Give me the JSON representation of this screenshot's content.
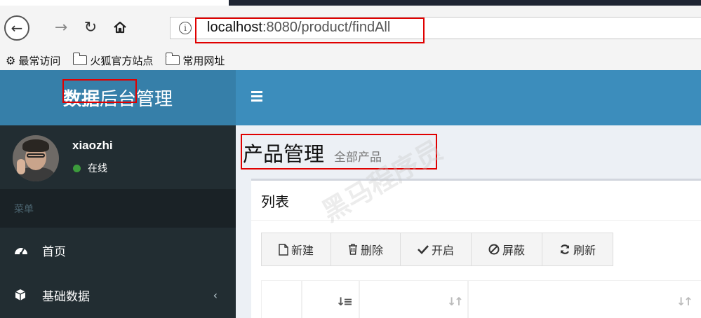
{
  "browser": {
    "url_host": "localhost",
    "url_port": ":8080",
    "url_path": "/product/findAll",
    "bookmarks": [
      {
        "label": "最常访问",
        "icon": "gear-icon"
      },
      {
        "label": "火狐官方站点",
        "icon": "folder-icon"
      },
      {
        "label": "常用网址",
        "icon": "folder-icon"
      }
    ]
  },
  "sidebar": {
    "logo_bold": "数据",
    "logo_rest": "后台管理",
    "user": {
      "name": "xiaozhi",
      "status": "在线"
    },
    "menu_header": "菜单",
    "items": [
      {
        "label": "首页",
        "icon": "dashboard-icon"
      },
      {
        "label": "基础数据",
        "icon": "cube-icon",
        "chevron": "‹"
      }
    ]
  },
  "page": {
    "title": "产品管理",
    "subtitle": "全部产品"
  },
  "box": {
    "title": "列表",
    "buttons": [
      {
        "label": "新建",
        "icon": "file-icon"
      },
      {
        "label": "删除",
        "icon": "trash-icon"
      },
      {
        "label": "开启",
        "icon": "check-icon"
      },
      {
        "label": "屏蔽",
        "icon": "ban-icon"
      },
      {
        "label": "刷新",
        "icon": "refresh-icon"
      }
    ]
  },
  "watermark": "黑马程序员",
  "colors": {
    "header_blue": "#3c8dbc",
    "logo_blue": "#367fa9",
    "sidebar_dark": "#222d32",
    "highlight_red": "#e00000",
    "online_green": "#3c9b3c"
  }
}
